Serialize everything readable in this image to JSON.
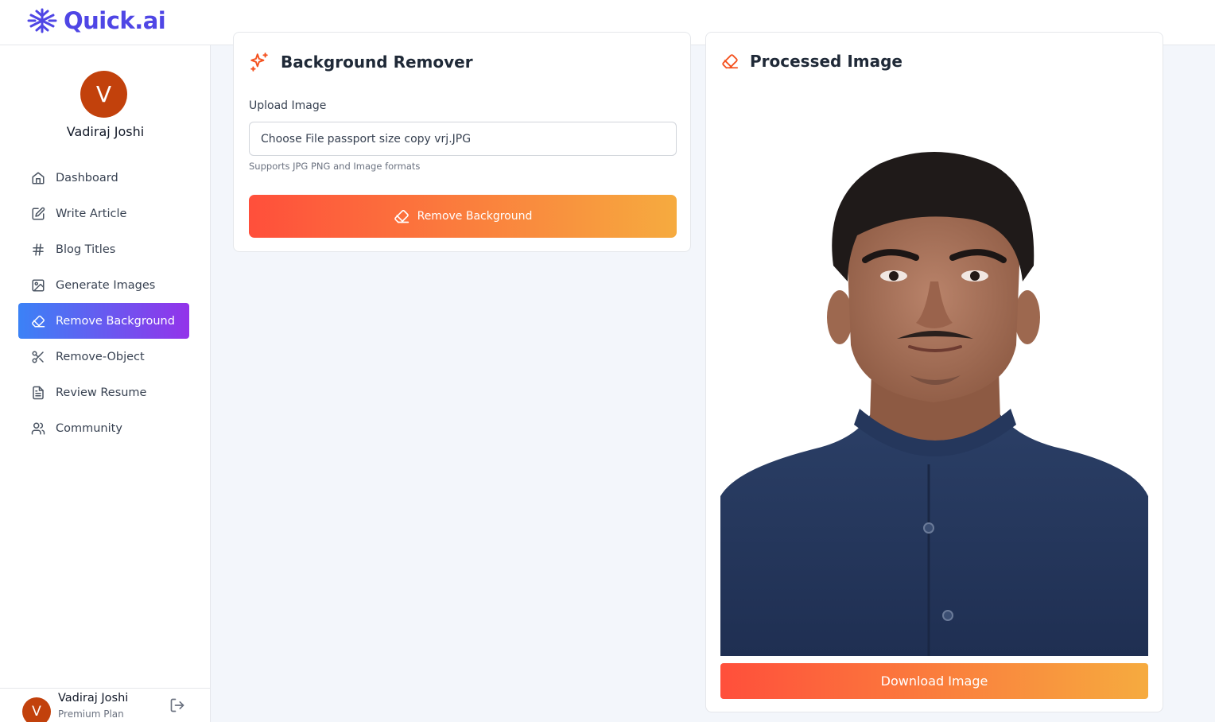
{
  "app": {
    "name": "Quick.ai"
  },
  "user": {
    "initial": "V",
    "name": "Vadiraj Joshi",
    "plan": "Premium Plan"
  },
  "sidebar": {
    "items": [
      {
        "label": "Dashboard",
        "icon": "home-icon"
      },
      {
        "label": "Write Article",
        "icon": "edit-icon"
      },
      {
        "label": "Blog Titles",
        "icon": "hash-icon"
      },
      {
        "label": "Generate Images",
        "icon": "image-icon"
      },
      {
        "label": "Remove Background",
        "icon": "eraser-icon",
        "active": true
      },
      {
        "label": "Remove-Object",
        "icon": "scissors-icon"
      },
      {
        "label": "Review Resume",
        "icon": "file-text-icon"
      },
      {
        "label": "Community",
        "icon": "users-icon"
      }
    ]
  },
  "remover": {
    "title": "Background Remover",
    "upload_label": "Upload Image",
    "file_button": "Choose File",
    "file_name": "passport size copy vrj.JPG",
    "hint": "Supports JPG PNG and Image formats",
    "button_label": "Remove Background"
  },
  "processed": {
    "title": "Processed Image",
    "download_label": "Download Image"
  },
  "colors": {
    "brand": "#4f46e5",
    "active_gradient_start": "#3b82f6",
    "active_gradient_end": "#9333ea",
    "action_gradient_start": "#ff4f3b",
    "action_gradient_end": "#f6ab3f",
    "avatar": "#c2410c"
  }
}
